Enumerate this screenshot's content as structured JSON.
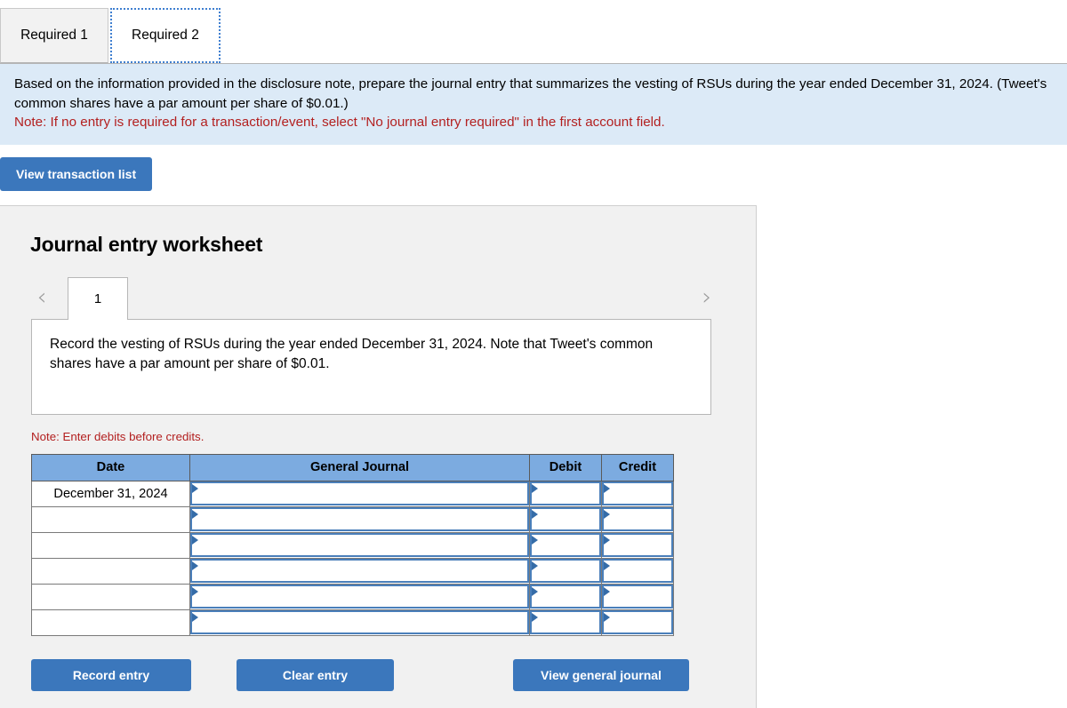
{
  "tabs": [
    {
      "label": "Required 1",
      "active": false
    },
    {
      "label": "Required 2",
      "active": true
    }
  ],
  "instructions": {
    "line1": "Based on the information provided in the disclosure note, prepare the journal entry that summarizes the vesting of RSUs during the year ended December 31, 2024. (Tweet's common shares have a par amount per share of $0.01.)",
    "note": "Note: If no entry is required for a transaction/event, select \"No journal entry required\" in the first account field."
  },
  "toolbar": {
    "view_transaction_list_label": "View transaction list"
  },
  "worksheet": {
    "title": "Journal entry worksheet",
    "pager": {
      "prev_icon": "‹",
      "next_icon": "›",
      "current_page": "1"
    },
    "description": "Record the vesting of RSUs during the year ended December 31, 2024. Note that Tweet's common shares have a par amount per share of $0.01.",
    "debit_note": "Note: Enter debits before credits.",
    "table": {
      "columns": [
        "Date",
        "General Journal",
        "Debit",
        "Credit"
      ],
      "rows": [
        {
          "date": "December 31, 2024",
          "general_journal": "",
          "debit": "",
          "credit": ""
        },
        {
          "date": "",
          "general_journal": "",
          "debit": "",
          "credit": ""
        },
        {
          "date": "",
          "general_journal": "",
          "debit": "",
          "credit": ""
        },
        {
          "date": "",
          "general_journal": "",
          "debit": "",
          "credit": ""
        },
        {
          "date": "",
          "general_journal": "",
          "debit": "",
          "credit": ""
        },
        {
          "date": "",
          "general_journal": "",
          "debit": "",
          "credit": ""
        }
      ]
    },
    "actions": {
      "record_entry": "Record entry",
      "clear_entry": "Clear entry",
      "view_general_journal": "View general journal"
    }
  },
  "colors": {
    "accent_blue": "#3b77bc",
    "table_header_blue": "#7cabe0",
    "instruction_bg": "#dceaf7",
    "note_red": "#b32020",
    "panel_gray": "#f1f1f1",
    "field_border": "#4a7fba"
  }
}
